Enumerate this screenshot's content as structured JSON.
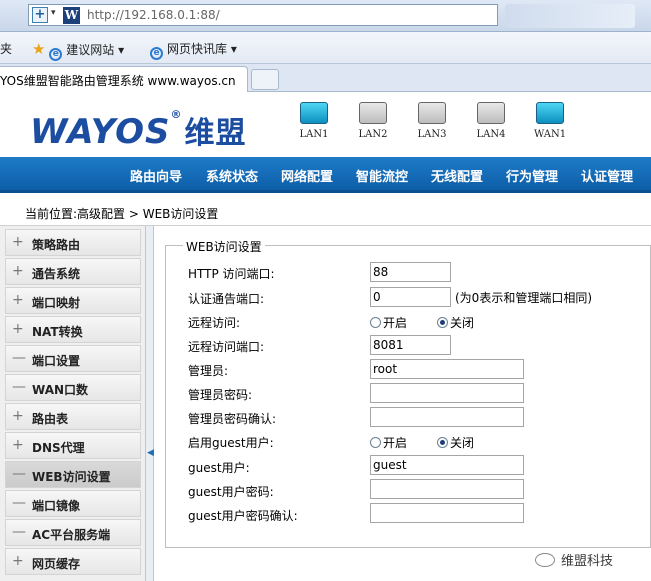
{
  "browser": {
    "url": "http://192.168.0.1:88/",
    "favorites": [
      "夹",
      "建议网站 ▾",
      "网页快讯库 ▾"
    ],
    "tab_title": "YOS维盟智能路由管理系统 www.wayos.cn"
  },
  "header": {
    "logo_text": "WAYOS",
    "logo_reg": "®",
    "logo_cn": "维盟",
    "ports": [
      {
        "label": "LAN1",
        "active": true
      },
      {
        "label": "LAN2",
        "active": false
      },
      {
        "label": "LAN3",
        "active": false
      },
      {
        "label": "LAN4",
        "active": false
      },
      {
        "label": "WAN1",
        "active": true
      }
    ]
  },
  "nav": [
    "路由向导",
    "系统状态",
    "网络配置",
    "智能流控",
    "无线配置",
    "行为管理",
    "认证管理"
  ],
  "breadcrumb": "当前位置:高级配置 > WEB访问设置",
  "sidebar": [
    {
      "sym": "+",
      "label": "策略路由"
    },
    {
      "sym": "+",
      "label": "通告系统"
    },
    {
      "sym": "+",
      "label": "端口映射"
    },
    {
      "sym": "+",
      "label": "NAT转换"
    },
    {
      "sym": "—",
      "label": "端口设置"
    },
    {
      "sym": "—",
      "label": "WAN口数"
    },
    {
      "sym": "+",
      "label": "路由表"
    },
    {
      "sym": "+",
      "label": "DNS代理"
    },
    {
      "sym": "—",
      "label": "WEB访问设置",
      "active": true
    },
    {
      "sym": "—",
      "label": "端口镜像"
    },
    {
      "sym": "—",
      "label": "AC平台服务端"
    },
    {
      "sym": "+",
      "label": "网页缓存"
    }
  ],
  "form": {
    "legend": "WEB访问设置",
    "http_port_label": "HTTP 访问端口:",
    "http_port_value": "88",
    "auth_port_label": "认证通告端口:",
    "auth_port_value": "0",
    "auth_port_hint": "(为0表示和管理端口相同)",
    "remote_label": "远程访问:",
    "remote_on": "开启",
    "remote_off": "关闭",
    "remote_port_label": "远程访问端口:",
    "remote_port_value": "8081",
    "admin_label": "管理员:",
    "admin_value": "root",
    "admin_pwd_label": "管理员密码:",
    "admin_pwd_confirm_label": "管理员密码确认:",
    "guest_enable_label": "启用guest用户:",
    "guest_on": "开启",
    "guest_off": "关闭",
    "guest_user_label": "guest用户:",
    "guest_user_value": "guest",
    "guest_pwd_label": "guest用户密码:",
    "guest_pwd_confirm_label": "guest用户密码确认:"
  },
  "watermark": "维盟科技"
}
